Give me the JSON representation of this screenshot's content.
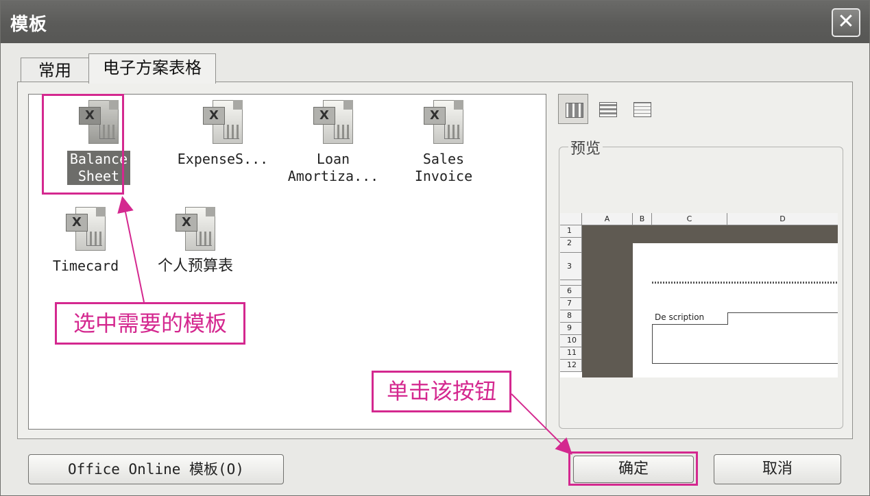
{
  "window": {
    "title": "模板",
    "close_glyph": "✕"
  },
  "tabs": [
    {
      "label": "常用",
      "active": false
    },
    {
      "label": "电子方案表格",
      "active": true
    }
  ],
  "templates": [
    {
      "label": "Balance\nSheet",
      "selected": true,
      "icon": "excel-template-icon"
    },
    {
      "label": "ExpenseS...",
      "selected": false,
      "icon": "excel-template-icon"
    },
    {
      "label": "Loan\nAmortiza...",
      "selected": false,
      "icon": "excel-template-icon"
    },
    {
      "label": "Sales\nInvoice",
      "selected": false,
      "icon": "excel-template-icon"
    },
    {
      "label": "Timecard",
      "selected": false,
      "icon": "excel-template-icon"
    },
    {
      "label": "个人预算表",
      "selected": false,
      "icon": "excel-template-icon"
    }
  ],
  "view_buttons": [
    {
      "icon": "large-icons-view-icon",
      "active": true
    },
    {
      "icon": "list-view-icon",
      "active": false
    },
    {
      "icon": "details-view-icon",
      "active": false
    }
  ],
  "preview": {
    "legend": "预览",
    "columns": [
      "A",
      "B",
      "C",
      "D"
    ],
    "rows": [
      "1",
      "2",
      "3",
      "6",
      "7",
      "8",
      "9",
      "10",
      "11",
      "12"
    ],
    "description_label": "De scription"
  },
  "buttons": {
    "online": "Office Online 模板(O)",
    "ok": "确定",
    "cancel": "取消"
  },
  "annotations": {
    "select_template": "选中需要的模板",
    "click_button": "单击该按钮"
  },
  "colors": {
    "annotation": "#d4288f",
    "title_bar": "#5e5e5c",
    "selection": "#6d6d6a"
  }
}
